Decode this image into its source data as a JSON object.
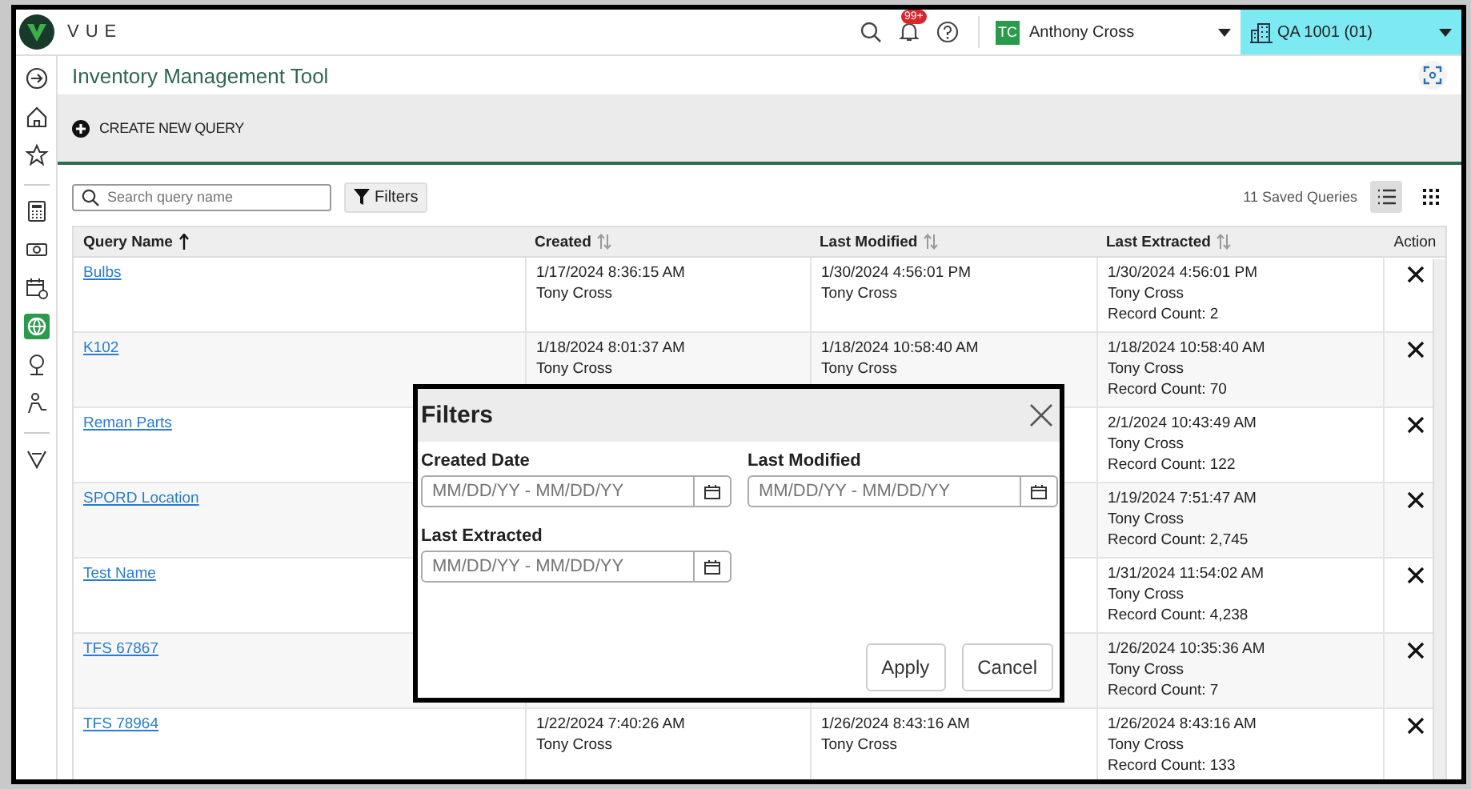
{
  "app": {
    "logo": "VUE"
  },
  "header": {
    "notification_badge": "99+",
    "user": {
      "initials": "TC",
      "name": "Anthony Cross"
    },
    "location": "QA 1001 (01)"
  },
  "sidebar": {
    "groups": [
      {
        "items": [
          {
            "kind": "exit",
            "selected": false
          },
          {
            "kind": "home",
            "selected": false
          },
          {
            "kind": "star",
            "selected": false
          }
        ]
      },
      {
        "items": [
          {
            "kind": "calculator",
            "selected": false
          },
          {
            "kind": "cash",
            "selected": false
          },
          {
            "kind": "calendar",
            "selected": false
          },
          {
            "kind": "globe",
            "selected": true
          },
          {
            "kind": "tree",
            "selected": false
          },
          {
            "kind": "worker",
            "selected": false
          }
        ]
      },
      {
        "items": [
          {
            "kind": "chevron",
            "selected": false
          }
        ]
      }
    ]
  },
  "page": {
    "title": "Inventory Management Tool",
    "create_button": "CREATE NEW QUERY"
  },
  "toolbar": {
    "search_placeholder": "Search query name",
    "filters_button": "Filters",
    "saved_count": "11 Saved Queries",
    "views": [
      {
        "kind": "list",
        "selected": true
      },
      {
        "kind": "grid",
        "selected": false
      }
    ]
  },
  "table": {
    "columns": [
      {
        "label": "Query Name",
        "sorted": true
      },
      {
        "label": "Created",
        "sorted": false
      },
      {
        "label": "Last Modified",
        "sorted": false
      },
      {
        "label": "Last Extracted",
        "sorted": false
      },
      {
        "label": "Action"
      }
    ],
    "rows": [
      {
        "name": "Bulbs",
        "created": [
          "1/17/2024 8:36:15 AM",
          "Tony Cross"
        ],
        "modified": [
          "1/30/2024 4:56:01 PM",
          "Tony Cross"
        ],
        "extracted": [
          "1/30/2024 4:56:01 PM",
          "Tony Cross",
          "Record Count: 2"
        ]
      },
      {
        "name": "K102",
        "created": [
          "1/18/2024 8:01:37 AM",
          "Tony Cross"
        ],
        "modified": [
          "1/18/2024 10:58:40 AM",
          "Tony Cross"
        ],
        "extracted": [
          "1/18/2024 10:58:40 AM",
          "Tony Cross",
          "Record Count: 70"
        ]
      },
      {
        "name": "Reman Parts",
        "extracted": [
          "2/1/2024 10:43:49 AM",
          "Tony Cross",
          "Record Count: 122"
        ]
      },
      {
        "name": "SPORD Location",
        "extracted": [
          "1/19/2024 7:51:47 AM",
          "Tony Cross",
          "Record Count: 2,745"
        ]
      },
      {
        "name": "Test Name",
        "extracted": [
          "1/31/2024 11:54:02 AM",
          "Tony Cross",
          "Record Count: 4,238"
        ]
      },
      {
        "name": "TFS 67867",
        "extracted": [
          "1/26/2024 10:35:36 AM",
          "Tony Cross",
          "Record Count: 7"
        ]
      },
      {
        "name": "TFS 78964",
        "created": [
          "1/22/2024 7:40:26 AM",
          "Tony Cross"
        ],
        "modified": [
          "1/26/2024 8:43:16 AM",
          "Tony Cross"
        ],
        "extracted": [
          "1/26/2024 8:43:16 AM",
          "Tony Cross",
          "Record Count: 133"
        ]
      }
    ]
  },
  "dialog": {
    "title": "Filters",
    "fields": [
      {
        "label": "Created Date",
        "placeholder": "MM/DD/YY - MM/DD/YY"
      },
      {
        "label": "Last Modified",
        "placeholder": "MM/DD/YY - MM/DD/YY"
      },
      {
        "label": "Last Extracted",
        "placeholder": "MM/DD/YY - MM/DD/YY"
      }
    ],
    "buttons": [
      "Apply",
      "Cancel"
    ]
  }
}
